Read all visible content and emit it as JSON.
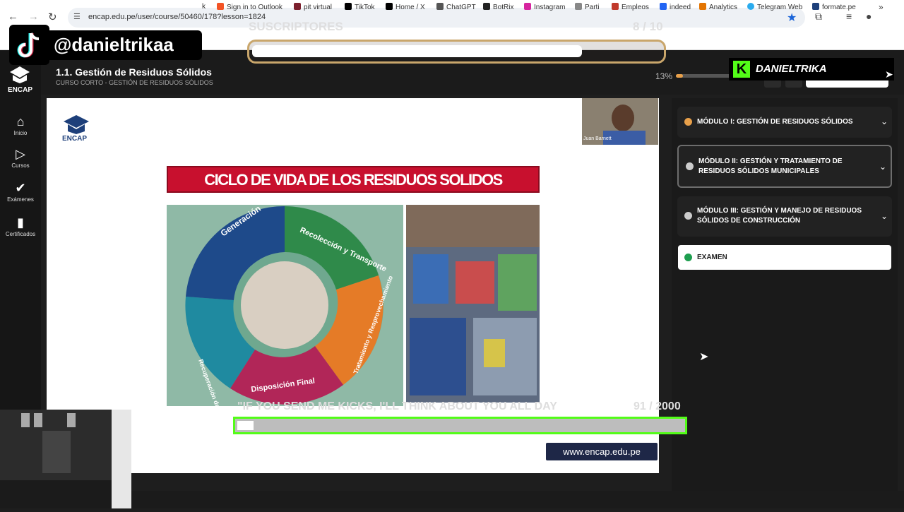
{
  "browser": {
    "url": "encap.edu.pe/user/course/50460/178?lesson=1824",
    "bookmarks": [
      "Sign in to Outlook",
      "pit virtual",
      "TikTok",
      "Home / X",
      "ChatGPT",
      "BotRix",
      "Instagram",
      "Parti",
      "Empleos",
      "indeed",
      "Analytics",
      "Telegram Web",
      "formate.pe"
    ],
    "bookmark_prefix": "k",
    "more": "»"
  },
  "header": {
    "logo": "ENCAP",
    "title": "1.1. Gestión de Residuos Sólidos",
    "subtitle": "CURSO CORTO - GESTIÓN DE RESIDUOS SÓLIDOS",
    "progress_text": "13%",
    "progress_value": 0.13
  },
  "sidebar": {
    "items": [
      {
        "label": "Inicio",
        "icon": "home-icon"
      },
      {
        "label": "Cursos",
        "icon": "play-circle-icon"
      },
      {
        "label": "Exámenes",
        "icon": "check-icon"
      },
      {
        "label": "Certificados",
        "icon": "bookmark-icon"
      }
    ]
  },
  "slide": {
    "logo": "ENCAP",
    "title": "CICLO DE VIDA DE LOS RESIDUOS SOLIDOS",
    "cycle_segments": [
      "Generación",
      "Recolección y Transporte",
      "Tratamiento y Reaprovechamiento",
      "Disposición Final",
      "Recuperación de Botaderos"
    ],
    "website": "www.encap.edu.pe",
    "presenter": "Juan Barnett"
  },
  "modules": [
    {
      "label": "MÓDULO I: GESTIÓN DE RESIDUOS SÓLIDOS",
      "status": "done"
    },
    {
      "label": "MÓDULO II: GESTIÓN Y TRATAMIENTO DE RESIDUOS SÓLIDOS MUNICIPALES",
      "status": "pending"
    },
    {
      "label": "MÓDULO III: GESTIÓN Y MANEJO DE RESIDUOS SÓLIDOS DE CONSTRUCCIÓN",
      "status": "pending"
    }
  ],
  "exam": {
    "label": "EXAMEN"
  },
  "overlay": {
    "tiktok_handle": "@danieltrikaa",
    "subs_label": "SUSCRIPTORES",
    "subs_count": "8 / 10",
    "subs_progress": 0.8,
    "kick_name": "DANIELTRIKA",
    "kick_message": "\"IF YOU SEND ME KICKS, I'LL THINK ABOUT YOU ALL DAY",
    "kick_count": "91 / 2000",
    "kick_progress": 0.0455
  },
  "colors": {
    "accent": "#e8a04a",
    "slide_title_bg": "#c8102e",
    "kick_green": "#53fc18",
    "exam_check": "#1e9e4f"
  }
}
